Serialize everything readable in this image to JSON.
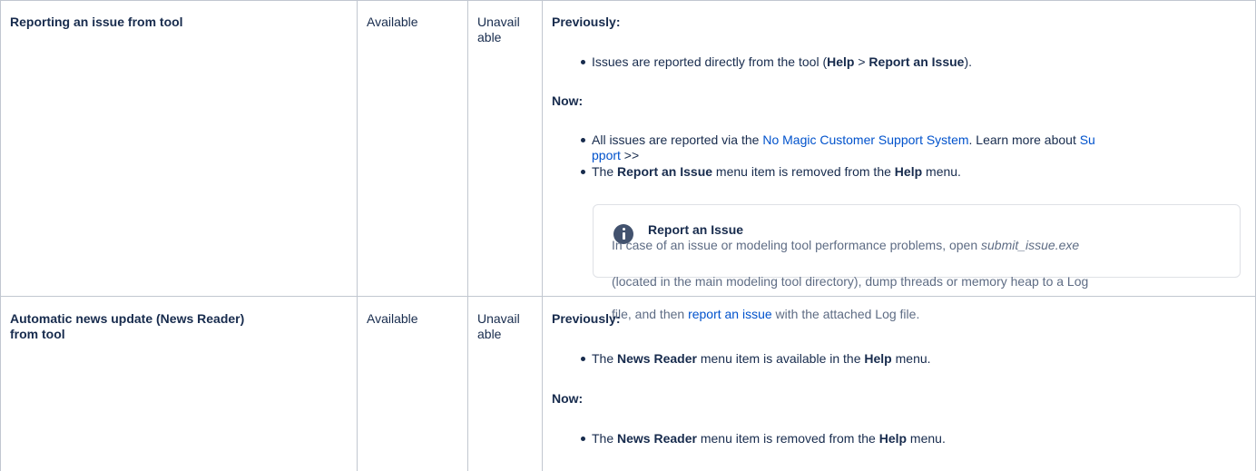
{
  "rows": [
    {
      "feature": "Reporting an issue from tool",
      "before": "Available",
      "after_part1": "Unavail",
      "after_part2": "able",
      "previously_label": "Previously:",
      "previously_item_prefix": "Issues are reported directly from the tool (",
      "previously_item_help": "Help",
      "previously_item_sep": " > ",
      "previously_item_report": "Report an Issue",
      "previously_item_suffix": ").",
      "now_label": "Now:",
      "now_item1_prefix": "All issues are reported via the ",
      "now_item1_link": "No Magic Customer Support System",
      "now_item1_mid": ". Learn more about ",
      "now_item1_link2_part1": "Su",
      "now_item1_link2_part2": "pport",
      "now_item1_suffix": " >>",
      "now_item2_prefix": "The ",
      "now_item2_bold": "Report an Issue",
      "now_item2_mid": " menu item is removed from the ",
      "now_item2_help": "Help",
      "now_item2_suffix": " menu.",
      "info_panel": {
        "title": "Report an Issue",
        "line1_prefix": "In case of an issue or modeling tool performance problems, open ",
        "line1_italic": "submit_issue.exe",
        "line2": "(located in the main modeling tool directory), dump threads or memory heap to a Log",
        "line3_prefix": "file, and then ",
        "line3_link": "report an issue",
        "line3_suffix": " with the attached Log file.",
        "icon": "info-icon"
      }
    },
    {
      "feature_part1": "Automatic news update (News Reader)",
      "feature_part2": "from tool",
      "before": "Available",
      "after_part1": "Unavail",
      "after_part2": "able",
      "previously_label": "Previously:",
      "previously_item_prefix": "The ",
      "previously_item_bold": "News Reader",
      "previously_item_mid": " menu item is available in the ",
      "previously_item_help": "Help",
      "previously_item_suffix": " menu.",
      "now_label": "Now:",
      "now_item_prefix": "The ",
      "now_item_bold": "News Reader",
      "now_item_mid": " menu item is removed from the ",
      "now_item_help": "Help",
      "now_item_suffix": " menu."
    }
  ]
}
